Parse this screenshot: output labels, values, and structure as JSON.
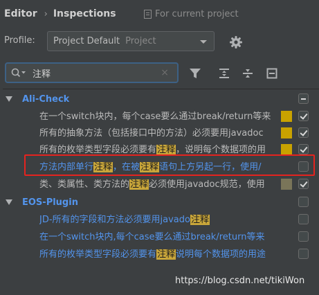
{
  "breadcrumb": {
    "root": "Editor",
    "separator": "›",
    "current": "Inspections",
    "scope": "For current project"
  },
  "profile": {
    "label": "Profile:",
    "name": "Project Default",
    "kind": "Project"
  },
  "search": {
    "value": "注释",
    "clear": "×"
  },
  "groups": [
    {
      "name": "Ali-Check"
    },
    {
      "name": "EOS-Plugin"
    }
  ],
  "items": [
    {
      "parts": [
        "在一个switch块内，每个case要么通过break/return等来"
      ]
    },
    {
      "parts": [
        "所有的抽象方法（包括接口中的方法）必须要用javadoc"
      ]
    },
    {
      "parts": [
        "所有的枚举类型字段必须要有",
        "注释",
        "，说明每个数据项的用"
      ]
    },
    {
      "parts": [
        "方法内部单行",
        "注释",
        "，在被",
        "注释",
        "语句上方另起一行，使用/"
      ]
    },
    {
      "parts": [
        "类、类属性、类方法的",
        "注释",
        "必须使用javadoc规范，使用"
      ]
    },
    {
      "parts": [
        "JD-所有的字段和方法必须要用javado",
        "注释"
      ]
    },
    {
      "parts": [
        "在一个switch块内,每个case要么通过break/return等来"
      ]
    },
    {
      "parts": [
        "所有的枚举类型字段必须要有",
        "注释",
        "说明每个数据项的用途"
      ]
    }
  ],
  "colors": {
    "group": "#5394ec",
    "highlight": "#c9a63a",
    "selection_outline": "#e5231f",
    "severity_warning": "#c9a200",
    "severity_weak": "#7a7559"
  },
  "watermark": "https://blog.csdn.net/tikiWon"
}
